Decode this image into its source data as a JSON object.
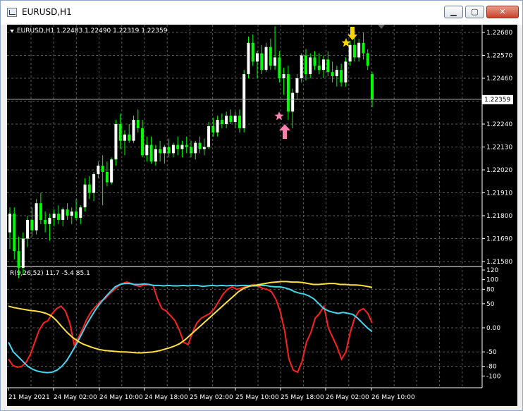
{
  "window": {
    "title": "EURUSD,H1",
    "buttons": {
      "minimize": "▁",
      "maximize": "▢",
      "close": "✕"
    }
  },
  "main_chart": {
    "header": "EURUSD,H1  1.22483 1.22490 1.22319 1.22359",
    "current_price_label": "1.22359",
    "current_price": 1.22359,
    "price_ticks": [
      "1.22680",
      "1.22570",
      "1.22460",
      "1.22350",
      "1.22240",
      "1.22130",
      "1.22020",
      "1.21910",
      "1.21800",
      "1.21690",
      "1.21580"
    ],
    "colors": {
      "bull": "#ffffff",
      "bear": "#00ff00",
      "grid": "#5a5a5a",
      "axis_text": "#ffffff",
      "background": "#000000"
    },
    "signals": [
      {
        "type": "sell-arrow",
        "color": "#ffd400",
        "icon": "down-arrow-icon"
      },
      {
        "type": "sell-star",
        "color": "#ffd400",
        "icon": "star-icon"
      },
      {
        "type": "buy-arrow",
        "color": "#ff7fb0",
        "icon": "up-arrow-icon"
      },
      {
        "type": "buy-star",
        "color": "#ff7fb0",
        "icon": "star-icon"
      }
    ]
  },
  "indicator": {
    "header": "R(9,26,52) 11.7 -5.4 85.1",
    "ticks": [
      "120",
      "100",
      "80",
      "50",
      "0.00",
      "-50",
      "-80",
      "-100"
    ],
    "colors": {
      "fast": "#ff2020",
      "mid": "#40d8f0",
      "slow": "#ffe040"
    }
  },
  "time_axis": {
    "labels": [
      "21 May 2021",
      "24 May 02:00",
      "24 May 10:00",
      "24 May 18:00",
      "25 May 02:00",
      "25 May 10:00",
      "25 May 18:00",
      "26 May 02:00",
      "26 May 10:00"
    ]
  },
  "chart_data": {
    "type": "candlestick",
    "symbol": "EURUSD",
    "timeframe": "H1",
    "ohlc_last": {
      "open": 1.22483,
      "high": 1.2249,
      "low": 1.22319,
      "close": 1.22359
    },
    "ylim": [
      1.2158,
      1.2268
    ],
    "indicator_ylim": [
      -120,
      120
    ],
    "candles": [
      [
        1.2172,
        1.2184,
        1.2164,
        1.2181
      ],
      [
        1.2181,
        1.2184,
        1.2159,
        1.2163
      ],
      [
        1.2163,
        1.217,
        1.215,
        1.2155
      ],
      [
        1.2155,
        1.2172,
        1.2152,
        1.2169
      ],
      [
        1.2169,
        1.218,
        1.2165,
        1.2178
      ],
      [
        1.2178,
        1.2184,
        1.217,
        1.2173
      ],
      [
        1.2173,
        1.2188,
        1.2171,
        1.2186
      ],
      [
        1.2186,
        1.2191,
        1.2176,
        1.2178
      ],
      [
        1.2178,
        1.2182,
        1.2172,
        1.2176
      ],
      [
        1.2176,
        1.2181,
        1.2168,
        1.2179
      ],
      [
        1.2179,
        1.2183,
        1.2175,
        1.2181
      ],
      [
        1.2181,
        1.2185,
        1.2176,
        1.2178
      ],
      [
        1.2178,
        1.2184,
        1.2175,
        1.2183
      ],
      [
        1.2183,
        1.2186,
        1.2178,
        1.218
      ],
      [
        1.218,
        1.2184,
        1.2176,
        1.2182
      ],
      [
        1.2182,
        1.2188,
        1.2178,
        1.2179
      ],
      [
        1.2179,
        1.2185,
        1.2176,
        1.2184
      ],
      [
        1.2184,
        1.2198,
        1.2182,
        1.2195
      ],
      [
        1.2195,
        1.2199,
        1.2188,
        1.2191
      ],
      [
        1.2191,
        1.2201,
        1.2187,
        1.22
      ],
      [
        1.22,
        1.2206,
        1.2198,
        1.2204
      ],
      [
        1.2204,
        1.2209,
        1.2185,
        1.2201
      ],
      [
        1.2201,
        1.2206,
        1.2194,
        1.2196
      ],
      [
        1.2196,
        1.2208,
        1.2195,
        1.2207
      ],
      [
        1.2207,
        1.2226,
        1.2204,
        1.2224
      ],
      [
        1.2224,
        1.2229,
        1.2212,
        1.2216
      ],
      [
        1.2216,
        1.2221,
        1.2209,
        1.2219
      ],
      [
        1.2219,
        1.2224,
        1.2215,
        1.2216
      ],
      [
        1.2216,
        1.2228,
        1.2215,
        1.2226
      ],
      [
        1.2226,
        1.2231,
        1.222,
        1.2222
      ],
      [
        1.2222,
        1.2226,
        1.2208,
        1.2209
      ],
      [
        1.2209,
        1.2218,
        1.2206,
        1.2214
      ],
      [
        1.2214,
        1.2218,
        1.2205,
        1.2206
      ],
      [
        1.2206,
        1.2214,
        1.2204,
        1.2212
      ],
      [
        1.2212,
        1.2216,
        1.2206,
        1.221
      ],
      [
        1.221,
        1.2214,
        1.2205,
        1.2213
      ],
      [
        1.2213,
        1.2217,
        1.2208,
        1.221
      ],
      [
        1.221,
        1.2215,
        1.2208,
        1.2214
      ],
      [
        1.2214,
        1.2218,
        1.2209,
        1.2212
      ],
      [
        1.2212,
        1.2216,
        1.2208,
        1.2214
      ],
      [
        1.2214,
        1.2218,
        1.221,
        1.2213
      ],
      [
        1.2213,
        1.2216,
        1.2208,
        1.221
      ],
      [
        1.221,
        1.2216,
        1.2207,
        1.2215
      ],
      [
        1.2215,
        1.2218,
        1.221,
        1.2212
      ],
      [
        1.2212,
        1.2217,
        1.2209,
        1.2213
      ],
      [
        1.2213,
        1.2225,
        1.2212,
        1.2223
      ],
      [
        1.2223,
        1.2227,
        1.2218,
        1.222
      ],
      [
        1.222,
        1.2228,
        1.2218,
        1.2226
      ],
      [
        1.2226,
        1.2229,
        1.2222,
        1.2224
      ],
      [
        1.2224,
        1.223,
        1.2222,
        1.2228
      ],
      [
        1.2228,
        1.2231,
        1.2224,
        1.2225
      ],
      [
        1.2225,
        1.223,
        1.2222,
        1.2228
      ],
      [
        1.2228,
        1.2231,
        1.222,
        1.2222
      ],
      [
        1.2222,
        1.225,
        1.222,
        1.2248
      ],
      [
        1.2248,
        1.2266,
        1.2246,
        1.2263
      ],
      [
        1.2263,
        1.2267,
        1.2252,
        1.2254
      ],
      [
        1.2254,
        1.2259,
        1.2246,
        1.2258
      ],
      [
        1.2258,
        1.2262,
        1.2248,
        1.225
      ],
      [
        1.225,
        1.2263,
        1.2249,
        1.2261
      ],
      [
        1.2261,
        1.2265,
        1.225,
        1.2252
      ],
      [
        1.2252,
        1.2271,
        1.225,
        1.2256
      ],
      [
        1.2256,
        1.2259,
        1.2244,
        1.2246
      ],
      [
        1.2246,
        1.2251,
        1.2238,
        1.2248
      ],
      [
        1.2248,
        1.2252,
        1.2226,
        1.223
      ],
      [
        1.223,
        1.2241,
        1.2222,
        1.2239
      ],
      [
        1.2239,
        1.2248,
        1.2236,
        1.2246
      ],
      [
        1.2246,
        1.2258,
        1.2244,
        1.2257
      ],
      [
        1.2257,
        1.226,
        1.2245,
        1.2248
      ],
      [
        1.2248,
        1.2258,
        1.2246,
        1.2256
      ],
      [
        1.2256,
        1.2259,
        1.225,
        1.2252
      ],
      [
        1.2252,
        1.2258,
        1.2248,
        1.225
      ],
      [
        1.225,
        1.2257,
        1.2246,
        1.2255
      ],
      [
        1.2255,
        1.2259,
        1.2247,
        1.2249
      ],
      [
        1.2249,
        1.2254,
        1.2244,
        1.2247
      ],
      [
        1.2247,
        1.2252,
        1.2242,
        1.225
      ],
      [
        1.225,
        1.2253,
        1.2242,
        1.2244
      ],
      [
        1.2244,
        1.2256,
        1.2242,
        1.2254
      ],
      [
        1.2254,
        1.2264,
        1.2252,
        1.2262
      ],
      [
        1.2262,
        1.2266,
        1.2254,
        1.2256
      ],
      [
        1.2256,
        1.2265,
        1.2254,
        1.2263
      ],
      [
        1.2263,
        1.2268,
        1.2255,
        1.2258
      ],
      [
        1.2258,
        1.226,
        1.225,
        1.2252
      ],
      [
        1.2248,
        1.2249,
        1.2232,
        1.2236
      ]
    ],
    "indicator_series": [
      {
        "values": [
          -65,
          -78,
          -82,
          -80,
          -72,
          -55,
          -30,
          -5,
          10,
          15,
          30,
          40,
          45,
          35,
          10,
          -35,
          -20,
          0,
          20,
          35,
          45,
          55,
          60,
          70,
          78,
          86,
          92,
          95,
          92,
          88,
          86,
          89,
          90,
          88,
          60,
          40,
          35,
          25,
          15,
          -5,
          -30,
          -35,
          -10,
          10,
          20,
          25,
          30,
          40,
          55,
          70,
          80,
          85,
          80,
          82,
          85,
          88,
          90,
          86,
          82,
          80,
          75,
          60,
          35,
          -5,
          -65,
          -88,
          -92,
          -70,
          -30,
          -10,
          20,
          30,
          45,
          0,
          -20,
          -40,
          -65,
          -50,
          -10,
          20,
          35,
          40,
          30,
          10
        ]
      },
      {
        "values": [
          -30,
          -50,
          -60,
          -70,
          -80,
          -86,
          -90,
          -92,
          -93,
          -92,
          -88,
          -80,
          -68,
          -52,
          -34,
          -15,
          5,
          22,
          38,
          52,
          64,
          75,
          85,
          90,
          92,
          92,
          90,
          90,
          91,
          90,
          88,
          88,
          87,
          88,
          87,
          87,
          88,
          87,
          88,
          88,
          86,
          87,
          88,
          87,
          88,
          87,
          88,
          87,
          88,
          88,
          87,
          87,
          88,
          88,
          86,
          85,
          85,
          83,
          80,
          75,
          72,
          70,
          66,
          60,
          50,
          40,
          35,
          32,
          30,
          32,
          30,
          28,
          20,
          10,
          0,
          -8
        ]
      },
      {
        "values": [
          45,
          42,
          40,
          38,
          36,
          35,
          33,
          30,
          25,
          15,
          2,
          -10,
          -20,
          -28,
          -34,
          -38,
          -42,
          -45,
          -47,
          -48,
          -49,
          -50,
          -50,
          -51,
          -52,
          -52,
          -51,
          -50,
          -48,
          -45,
          -42,
          -38,
          -33,
          -25,
          -15,
          -5,
          5,
          15,
          25,
          35,
          45,
          55,
          65,
          75,
          82,
          86,
          88,
          90,
          92,
          94,
          95,
          96,
          96,
          95,
          95,
          94,
          92,
          90,
          90,
          91,
          92,
          92,
          90,
          90,
          89,
          89,
          88,
          86,
          84
        ]
      }
    ]
  }
}
